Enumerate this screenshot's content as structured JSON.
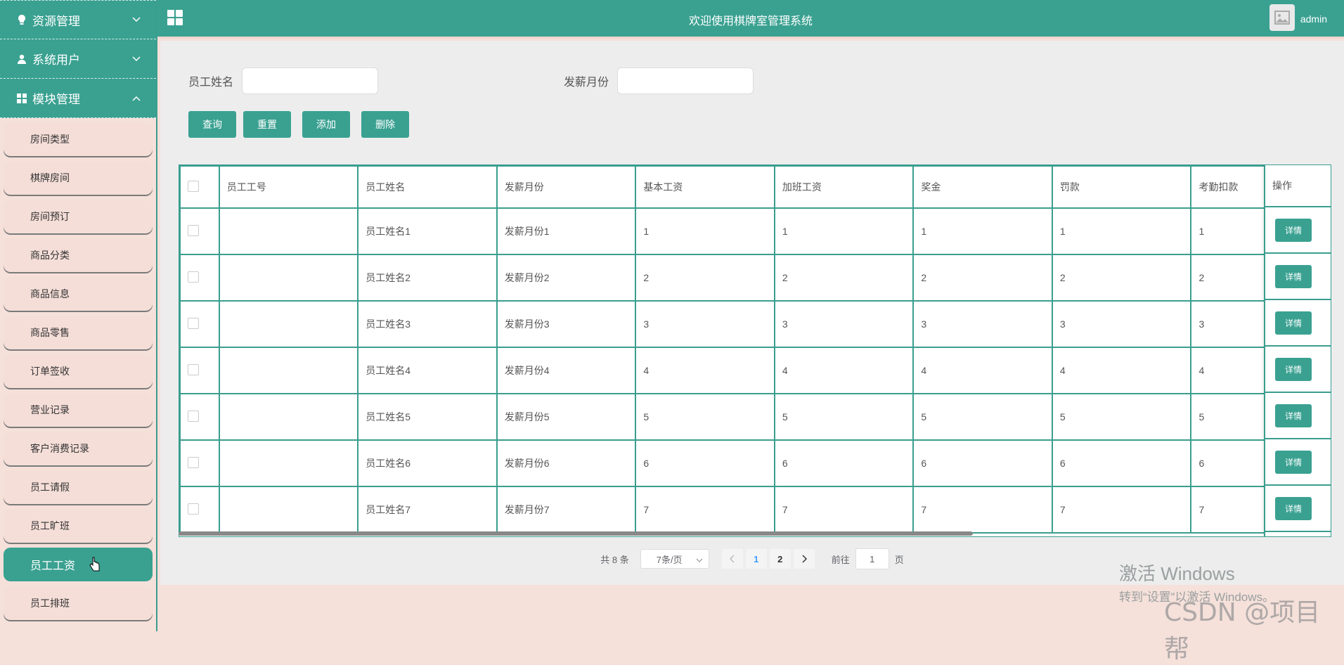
{
  "header": {
    "title": "欢迎使用棋牌室管理系统",
    "username": "admin"
  },
  "sidebar": {
    "groups": [
      {
        "label": "资源管理",
        "icon": "bulb-icon",
        "expanded": false
      },
      {
        "label": "系统用户",
        "icon": "user-icon",
        "expanded": false
      },
      {
        "label": "模块管理",
        "icon": "grid-icon",
        "expanded": true
      }
    ],
    "items": [
      {
        "label": "房间类型"
      },
      {
        "label": "棋牌房间"
      },
      {
        "label": "房间预订"
      },
      {
        "label": "商品分类"
      },
      {
        "label": "商品信息"
      },
      {
        "label": "商品零售"
      },
      {
        "label": "订单签收"
      },
      {
        "label": "营业记录"
      },
      {
        "label": "客户消费记录"
      },
      {
        "label": "员工请假"
      },
      {
        "label": "员工旷班"
      },
      {
        "label": "员工工资",
        "active": true
      },
      {
        "label": "员工排班"
      }
    ]
  },
  "search": {
    "name_label": "员工姓名",
    "name_value": "",
    "month_label": "发薪月份",
    "month_value": ""
  },
  "buttons": {
    "query": "查询",
    "reset": "重置",
    "add": "添加",
    "delete": "删除"
  },
  "table": {
    "headers": [
      "员工工号",
      "员工姓名",
      "发薪月份",
      "基本工资",
      "加班工资",
      "奖金",
      "罚款",
      "考勤扣款"
    ],
    "op_header": "操作",
    "detail_label": "详情",
    "rows": [
      [
        "",
        "员工姓名1",
        "发薪月份1",
        "1",
        "1",
        "1",
        "1",
        "1"
      ],
      [
        "",
        "员工姓名2",
        "发薪月份2",
        "2",
        "2",
        "2",
        "2",
        "2"
      ],
      [
        "",
        "员工姓名3",
        "发薪月份3",
        "3",
        "3",
        "3",
        "3",
        "3"
      ],
      [
        "",
        "员工姓名4",
        "发薪月份4",
        "4",
        "4",
        "4",
        "4",
        "4"
      ],
      [
        "",
        "员工姓名5",
        "发薪月份5",
        "5",
        "5",
        "5",
        "5",
        "5"
      ],
      [
        "",
        "员工姓名6",
        "发薪月份6",
        "6",
        "6",
        "6",
        "6",
        "6"
      ],
      [
        "",
        "员工姓名7",
        "发薪月份7",
        "7",
        "7",
        "7",
        "7",
        "7"
      ]
    ]
  },
  "pagination": {
    "total": "共 8 条",
    "page_size": "7条/页",
    "pages": [
      "1",
      "2"
    ],
    "current": "1",
    "goto_label": "前往",
    "goto_value": "1",
    "page_suffix": "页"
  },
  "watermark": {
    "win_line1": "激活 Windows",
    "win_line2": "转到“设置”以激活 Windows。",
    "csdn": "CSDN @项目帮"
  }
}
